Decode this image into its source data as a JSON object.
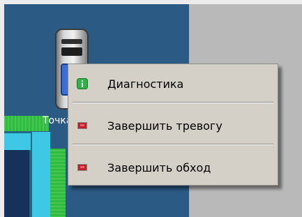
{
  "device": {
    "label": "Точка",
    "icon": "server-device-icon"
  },
  "context_menu": {
    "items": [
      {
        "label": "Диагностика",
        "icon": "info-icon",
        "icon_color": "#2fb344"
      },
      {
        "label": "Завершить тревогу",
        "icon": "stop-icon",
        "icon_color": "#c0202a"
      },
      {
        "label": "Завершить обход",
        "icon": "stop-icon",
        "icon_color": "#c0202a"
      }
    ]
  },
  "colors": {
    "map_background": "#2b5a84",
    "side_panel": "#b9b9b9",
    "zone_green": "#2ebd3c",
    "zone_cyan": "#3fc7e6",
    "menu_background": "#d4d0c8"
  }
}
